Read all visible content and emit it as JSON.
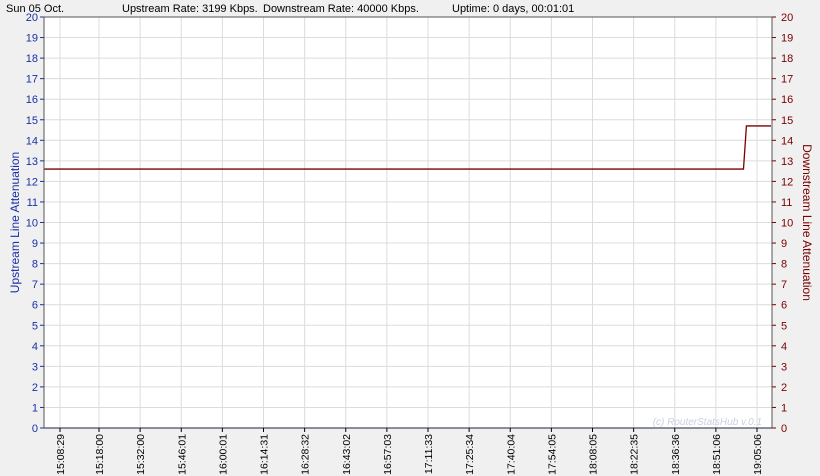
{
  "header": {
    "date": "Sun 05 Oct.",
    "upstream_rate": "Upstream Rate: 3199 Kbps.",
    "downstream_rate": "Downstream Rate: 40000 Kbps.",
    "uptime": "Uptime: 0 days, 00:01:01"
  },
  "watermark": "(c) RouterStatsHub v.0.1",
  "colors": {
    "upstream": "#1a2fa8",
    "downstream": "#7a0000",
    "grid": "#dcdcdc",
    "plot_bg": "#ffffff",
    "frame": "#555555"
  },
  "chart_data": {
    "type": "line",
    "ylabel_left": "Upstream Line Attenuation",
    "ylabel_right": "Downstream Line Attenuation",
    "ylim": [
      0,
      20
    ],
    "yticks": [
      0,
      1,
      2,
      3,
      4,
      5,
      6,
      7,
      8,
      9,
      10,
      11,
      12,
      13,
      14,
      15,
      16,
      17,
      18,
      19,
      20
    ],
    "x_tick_labels": [
      "15:08:29",
      "15:18:00",
      "15:32:00",
      "15:46:01",
      "16:00:01",
      "16:14:31",
      "16:28:32",
      "16:43:02",
      "16:57:03",
      "17:11:33",
      "17:25:34",
      "17:40:04",
      "17:54:05",
      "18:08:05",
      "18:22:35",
      "18:36:36",
      "18:51:06",
      "19:05:06"
    ],
    "grid": true,
    "series": [
      {
        "name": "Upstream Line Attenuation",
        "axis": "left",
        "x": [
          "15:08:29",
          "19:05:06"
        ],
        "y": [
          0,
          0
        ]
      },
      {
        "name": "Downstream Line Attenuation",
        "axis": "right",
        "x": [
          "15:08:29",
          "19:00:30",
          "19:01:30",
          "19:05:06",
          "19:08:00"
        ],
        "y": [
          12.6,
          12.6,
          14.7,
          14.7,
          14.7
        ]
      }
    ]
  }
}
